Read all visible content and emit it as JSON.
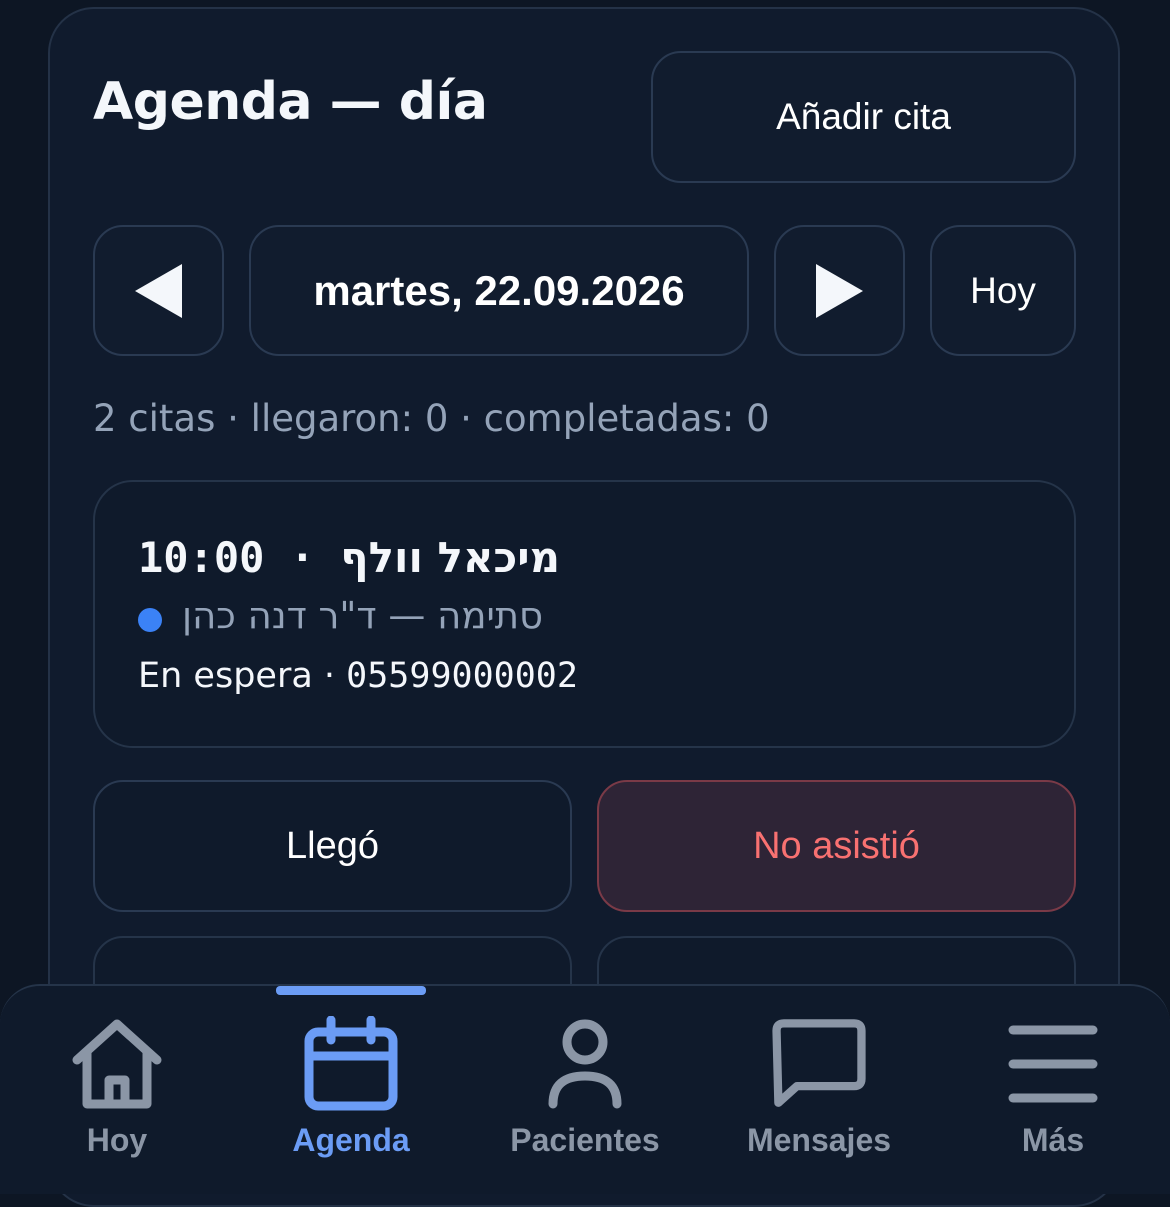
{
  "page": {
    "title": "Agenda — día"
  },
  "header": {
    "add_button": "Añadir cita"
  },
  "date_nav": {
    "date_label": "martes, 22.09.2026",
    "today_button": "Hoy"
  },
  "summary": "2 citas · llegaron: 0 · completadas: 0",
  "appointment": {
    "time": "10:00",
    "separator": " · ",
    "patient": "מיכאל וולף",
    "type_line": "סתימה — ד\"ר דנה כהן",
    "status": "En espera · ",
    "phone": "05599000002",
    "dot_color": "#3b82f6"
  },
  "actions": {
    "arrived": "Llegó",
    "no_show": "No asistió"
  },
  "bottom_nav": {
    "items": [
      {
        "label": "Hoy",
        "icon": "home-icon",
        "active": false
      },
      {
        "label": "Agenda",
        "icon": "calendar-icon",
        "active": true
      },
      {
        "label": "Pacientes",
        "icon": "user-icon",
        "active": false
      },
      {
        "label": "Mensajes",
        "icon": "chat-icon",
        "active": false
      },
      {
        "label": "Más",
        "icon": "menu-icon",
        "active": false
      }
    ]
  },
  "colors": {
    "background": "#0d1624",
    "card": "#101b2d",
    "accent": "#6b9cf5",
    "danger": "#f87171",
    "muted": "#94a3b8"
  }
}
